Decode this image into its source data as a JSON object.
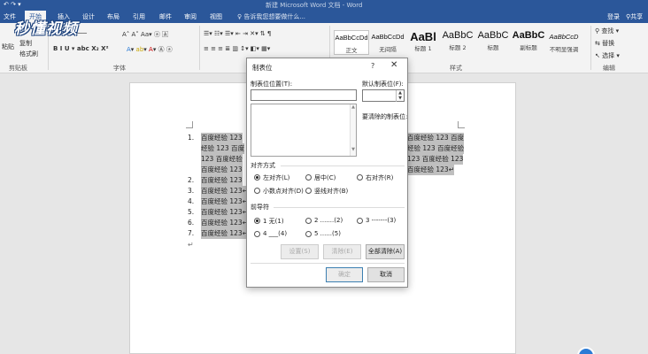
{
  "window": {
    "title": "新建 Microsoft Word 文档 - Word"
  },
  "tabs": [
    "文件",
    "开始",
    "插入",
    "设计",
    "布局",
    "引用",
    "邮件",
    "审阅",
    "视图"
  ],
  "tell_me": "告诉我您想要做什么...",
  "account": {
    "login": "登录",
    "share": "共享"
  },
  "watermark": "秒懂视频",
  "ribbon": {
    "clipboard": {
      "paste": "粘贴",
      "cut": "剪切",
      "copy": "复制",
      "format_painter": "格式刷",
      "label": "剪贴板"
    },
    "font": {
      "label": "字体"
    },
    "paragraph": {
      "label": "段落"
    },
    "styles": {
      "label": "样式",
      "items": [
        {
          "preview": "AaBbCcDd",
          "name": "正文"
        },
        {
          "preview": "AaBbCcDd",
          "name": "无间隔"
        },
        {
          "preview": "AaBl",
          "name": "标题 1"
        },
        {
          "preview": "AaBbC",
          "name": "标题 2"
        },
        {
          "preview": "AaBbC",
          "name": "标题"
        },
        {
          "preview": "AaBbC",
          "name": "副标题"
        },
        {
          "preview": "AaBbCcD",
          "name": "不明显强调"
        }
      ]
    },
    "editing": {
      "label": "编辑",
      "find": "查找",
      "replace": "替换",
      "select": "选择"
    }
  },
  "document": {
    "list_items": [
      {
        "num": "1.",
        "lines": [
          "百度经验 123",
          "经验 123 百度",
          "123 百度经验",
          "百度经验 123"
        ]
      },
      {
        "num": "2.",
        "lines": [
          "百度经验 123"
        ]
      },
      {
        "num": "3.",
        "lines": [
          "百度经验 123↵"
        ]
      },
      {
        "num": "4.",
        "lines": [
          "百度经验 123↵"
        ]
      },
      {
        "num": "5.",
        "lines": [
          "百度经验 123↵"
        ]
      },
      {
        "num": "6.",
        "lines": [
          "百度经验 123↵"
        ]
      },
      {
        "num": "7.",
        "lines": [
          "百度经验 123↵"
        ]
      }
    ],
    "right_lines": [
      "百度经验 123 百度",
      "经验 123 百度经验",
      "123 百度经验 123",
      "百度经验 123↵"
    ],
    "second_line_tail": "百度经验",
    "para_mark": "↵"
  },
  "dialog": {
    "title": "制表位",
    "help": "?",
    "close": "✕",
    "tab_position_label": "制表位位置(T):",
    "tab_position_value": "",
    "default_tab_label": "默认制表位(F):",
    "default_tab_value": "",
    "to_clear_label": "要清除的制表位:",
    "alignment": {
      "label": "对齐方式",
      "options": [
        "左对齐(L)",
        "居中(C)",
        "右对齐(R)",
        "小数点对齐(D)",
        "竖线对齐(B)"
      ],
      "selected": 0
    },
    "leader": {
      "label": "前导符",
      "options": [
        "1 无(1)",
        "2 .......(2)",
        "3 -------(3)",
        "4 ___(4)",
        "5 ......(5)"
      ],
      "selected": 0
    },
    "buttons": {
      "set": "设置(S)",
      "clear": "清除(E)",
      "clear_all": "全部清除(A)",
      "ok": "确定",
      "cancel": "取消"
    }
  }
}
